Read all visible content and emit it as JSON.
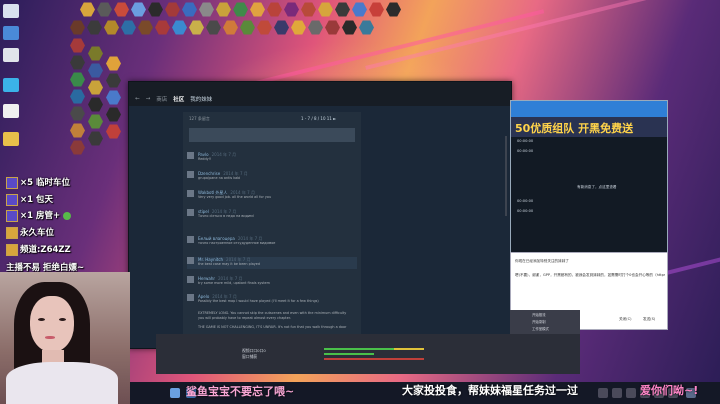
{
  "overlay": {
    "lines": [
      {
        "label": "×5 临时车位"
      },
      {
        "label": "×1 包天"
      },
      {
        "label": "×1 房管+"
      },
      {
        "label": "永久车位"
      },
      {
        "label": "频道:Z64ZZ"
      },
      {
        "label": "主播不易 拒绝白嫖~"
      }
    ],
    "subtitle_left": "鲨鱼宝宝不要忘了喂~",
    "subtitle_right": "大家投投食，帮妹妹福星任务过一过",
    "subtitle_right2": "爱你们呦~!"
  },
  "steam": {
    "nav": {
      "back": "←",
      "forward": "→",
      "store": "商店",
      "community": "社区",
      "library_title": "我的妹妹"
    },
    "thread_header": "127 条留言",
    "pager": "1 - 7 / 8 / 10 11 ►",
    "comments": [
      {
        "name": "Pavlo",
        "time": "2014 年 7 月",
        "text": "Reddy!!"
      },
      {
        "name": "Dzenchrise",
        "time": "2014 年 7 月",
        "text": "grupa/pane na antis kabi"
      },
      {
        "name": "Wakbotl 外星人",
        "time": "2014 年 7 月",
        "text": "Very very good job. all the world all for you"
      },
      {
        "name": "stipel",
        "time": "2014 年 7 月",
        "text": "Точно сіється в недо на видимі"
      },
      {
        "name": "Белый влагоцера",
        "time": "2014 年 7 月",
        "text": "точно настроенное отсудуденное видимое"
      },
      {
        "name": "Mr. Haynitch",
        "time": "2014 年 7 月",
        "text": "the best case may it be been played"
      },
      {
        "name": "Herwahr",
        "time": "2014 年 7 月",
        "text": "try some more mild, upstant finals system"
      },
      {
        "name": "Apelo",
        "time": "2014 年 7 月",
        "text": "Possibly the best map I would have played (I'll meet it for a few things)"
      }
    ],
    "long_text_1": "EXTREMELY LONG. You cannot skip the cutscenes and even with the minimum difficulty",
    "long_text_2": "you will probably have to repeat almost every chapter.",
    "long_text_3": "THE GAME IS NOT CHALLENGING, IT'S UNFAIR. It's not fun that you walk through a door"
  },
  "right_window": {
    "banner": "50优质组队 开黑免费送",
    "side_items": [
      "00:00:00",
      "00:00:00",
      "00:00:00",
      "00:00:00"
    ],
    "center_text": "有新消息了，点这里查看",
    "panel_line_1": "你现在已经添加特别关注的妹妹了",
    "panel_line_2": "嗯(不要)，谢谢，GPP，开黑都有的，被我会发到妹妹的，如需需时打个0也会开心等的（https://tapy.n",
    "buttons": [
      "关闭(C)",
      "发送(S)"
    ]
  },
  "obs": {
    "source_1": "视频口口0口0",
    "source_2": "窗口捕获",
    "right_items": [
      "开始推流",
      "开始录制",
      "工作室模式",
      "设置",
      "退出"
    ]
  }
}
